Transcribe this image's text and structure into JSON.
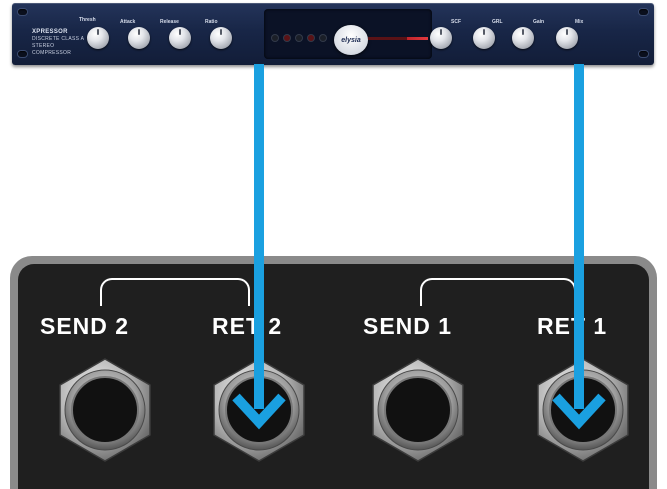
{
  "rack": {
    "model": "XPRESSOR",
    "description_line1": "DISCRETE CLASS A",
    "description_line2": "STEREO COMPRESSOR",
    "brand": "elysia",
    "knobs_left": [
      "Thresh",
      "Attack",
      "Release",
      "Ratio"
    ],
    "knobs_right": [
      "SCF",
      "GRL",
      "Gain",
      "Mix"
    ]
  },
  "patchbay": {
    "jacks": [
      {
        "label": "SEND 2"
      },
      {
        "label": "RET 2"
      },
      {
        "label": "SEND 1"
      },
      {
        "label": "RET 1"
      }
    ]
  },
  "colors": {
    "arrow": "#1aa0e0",
    "rack": "#1a284a",
    "panel": "#1f1f1f"
  }
}
